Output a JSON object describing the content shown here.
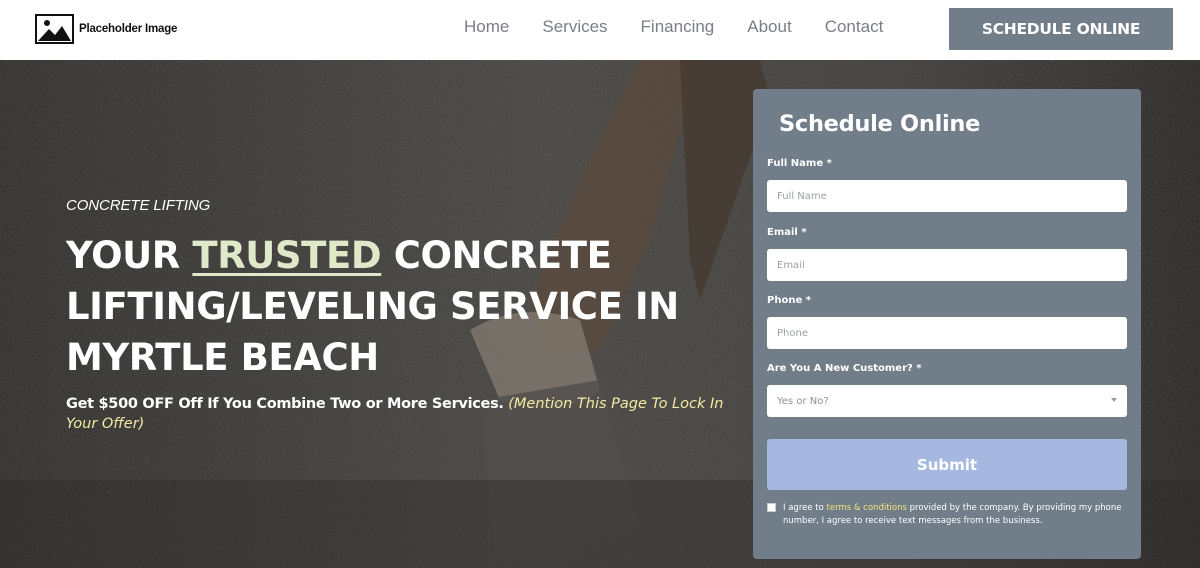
{
  "header": {
    "logo_text": "Placeholder Image",
    "nav": [
      "Home",
      "Services",
      "Financing",
      "About",
      "Contact"
    ],
    "cta_label": "SCHEDULE ONLINE"
  },
  "hero": {
    "eyebrow": "CONCRETE LIFTING",
    "headline_pre": "YOUR ",
    "headline_highlight": "TRUSTED",
    "headline_post": " CONCRETE LIFTING/LEVELING SERVICE IN MYRTLE BEACH",
    "offer_strong": "Get $500 OFF Off If You Combine Two or More Services.",
    "offer_note": "(Mention This Page To Lock In Your Offer)"
  },
  "form": {
    "title": "Schedule Online",
    "fields": [
      {
        "label": "Full Name *",
        "placeholder": "Full Name"
      },
      {
        "label": "Email *",
        "placeholder": "Email"
      },
      {
        "label": "Phone *",
        "placeholder": "Phone"
      },
      {
        "label": "Are You A New Customer? *",
        "placeholder": "Yes or No?"
      }
    ],
    "submit_label": "Submit",
    "consent_pre": "I agree to ",
    "consent_link": "terms & conditions",
    "consent_post": " provided by the company. By providing my phone number, I agree to receive text messages from the business."
  },
  "colors": {
    "accent": "#717d89",
    "submit": "#a6b8e0",
    "highlight": "#dfe8c8",
    "note": "#f2e9a3",
    "link": "#f6e27a"
  }
}
